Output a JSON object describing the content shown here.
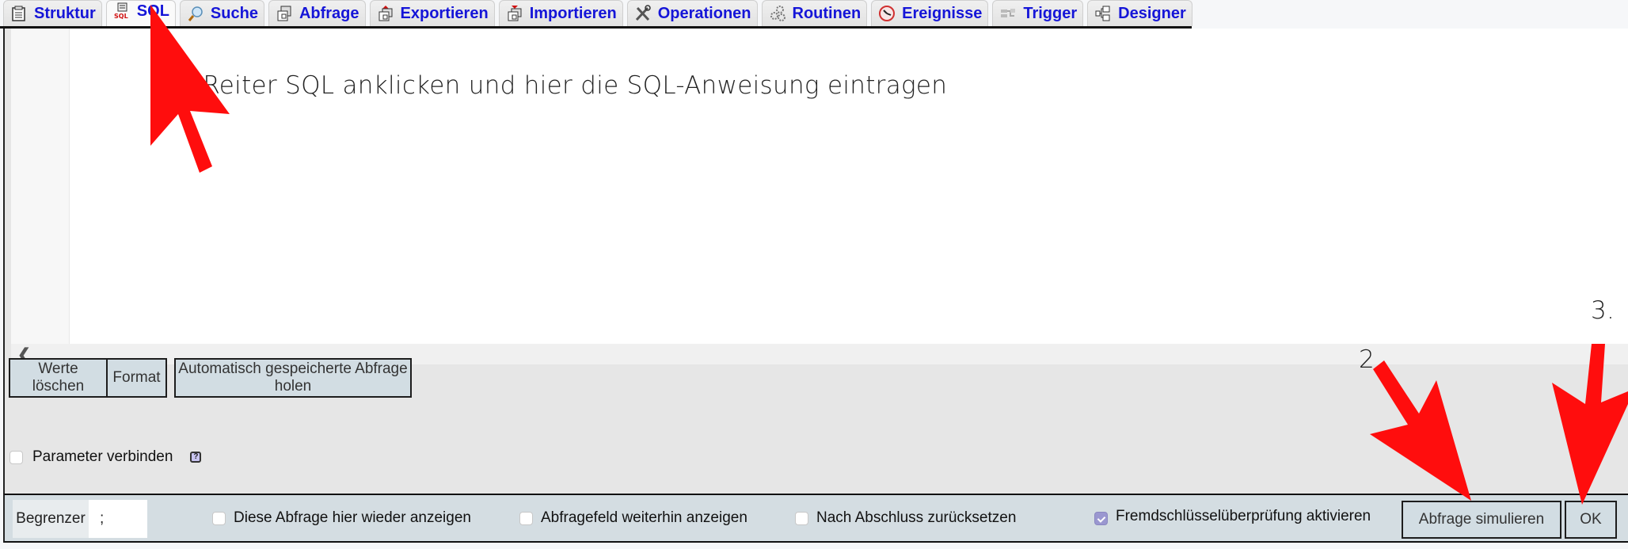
{
  "tabs": [
    {
      "label": "Struktur",
      "icon": "structure-icon",
      "active": false
    },
    {
      "label": "SQL",
      "icon": "sql-icon",
      "active": true
    },
    {
      "label": "Suche",
      "icon": "magnifier-icon",
      "active": false
    },
    {
      "label": "Abfrage",
      "icon": "query-icon",
      "active": false
    },
    {
      "label": "Exportieren",
      "icon": "export-icon",
      "active": false
    },
    {
      "label": "Importieren",
      "icon": "import-icon",
      "active": false
    },
    {
      "label": "Operationen",
      "icon": "tools-icon",
      "active": false
    },
    {
      "label": "Routinen",
      "icon": "gears-icon",
      "active": false
    },
    {
      "label": "Ereignisse",
      "icon": "clock-icon",
      "active": false
    },
    {
      "label": "Trigger",
      "icon": "trigger-icon",
      "active": false
    },
    {
      "label": "Designer",
      "icon": "designer-icon",
      "active": false
    }
  ],
  "editor": {
    "content": "",
    "scroll_left_icon": "chevron-left-icon",
    "scroll_left_glyph": "❮"
  },
  "buttons": {
    "clear": "Werte löschen",
    "format": "Format",
    "autosave": "Automatisch gespeicherte Abfrage holen",
    "simulate": "Abfrage simulieren",
    "ok": "OK"
  },
  "bind_parameters": {
    "label": "Parameter verbinden",
    "checked": false,
    "help_glyph": "?"
  },
  "bottombar": {
    "delimiter_label": "Begrenzer",
    "delimiter_value": ";",
    "options": [
      {
        "label": "Diese Abfrage hier wieder anzeigen",
        "checked": false
      },
      {
        "label": "Abfragefeld weiterhin anzeigen",
        "checked": false
      },
      {
        "label": "Nach Abschluss zurücksetzen",
        "checked": false
      },
      {
        "label": "Fremdschlüsselüberprüfung aktivieren",
        "checked": true
      }
    ]
  },
  "annotations": {
    "step1": "1. Reiter SQL anklicken und hier die SQL-Anweisung eintragen",
    "step2": "2.",
    "step3": "3.",
    "arrow_color": "#ff0d0d"
  },
  "colors": {
    "tab_text": "#1515d8",
    "button_bg": "#d2dde3",
    "checkbox_checked": "#9a97d0"
  }
}
